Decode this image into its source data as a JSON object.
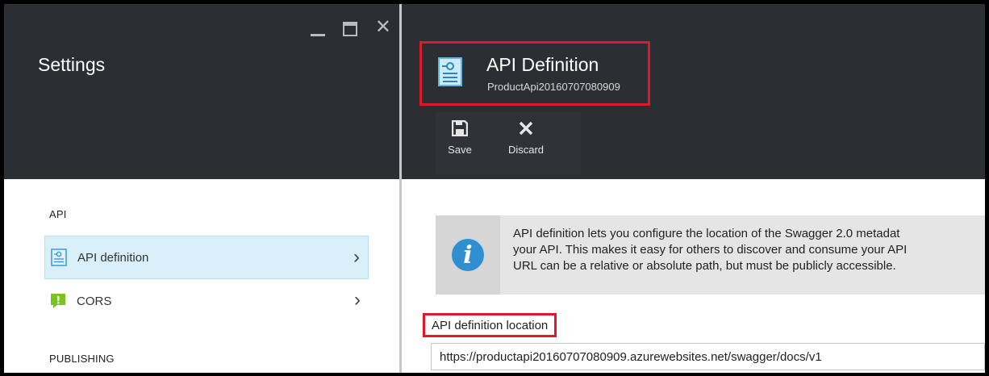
{
  "settings": {
    "title": "Settings",
    "window_controls": {
      "minimize": "minimize-icon",
      "maximize": "maximize-icon",
      "close": "close-icon"
    },
    "sections": [
      {
        "label": "API",
        "items": [
          {
            "label": "API definition",
            "icon": "api-definition-icon",
            "selected": true
          },
          {
            "label": "CORS",
            "icon": "cors-icon",
            "selected": false
          }
        ]
      },
      {
        "label": "PUBLISHING",
        "items": []
      }
    ]
  },
  "blade": {
    "title": "API Definition",
    "subtitle": "ProductApi20160707080909",
    "commands": [
      {
        "label": "Save",
        "icon": "save-icon"
      },
      {
        "label": "Discard",
        "icon": "discard-icon"
      }
    ],
    "info": {
      "lines": [
        "API definition lets you configure the location of the Swagger 2.0 metadat",
        "your API. This makes it easy for others to discover and consume your API",
        "URL can be a relative or absolute path, but must be publicly accessible."
      ]
    },
    "location_label": "API definition location",
    "location_value": "https://productapi20160707080909.azurewebsites.net/swagger/docs/v1"
  },
  "colors": {
    "header_bg": "#2b2f33",
    "selected_bg": "#d9f0fb",
    "highlight_border": "#e0192a",
    "info_blue": "#2f8fd0",
    "cors_green": "#7cc221"
  }
}
